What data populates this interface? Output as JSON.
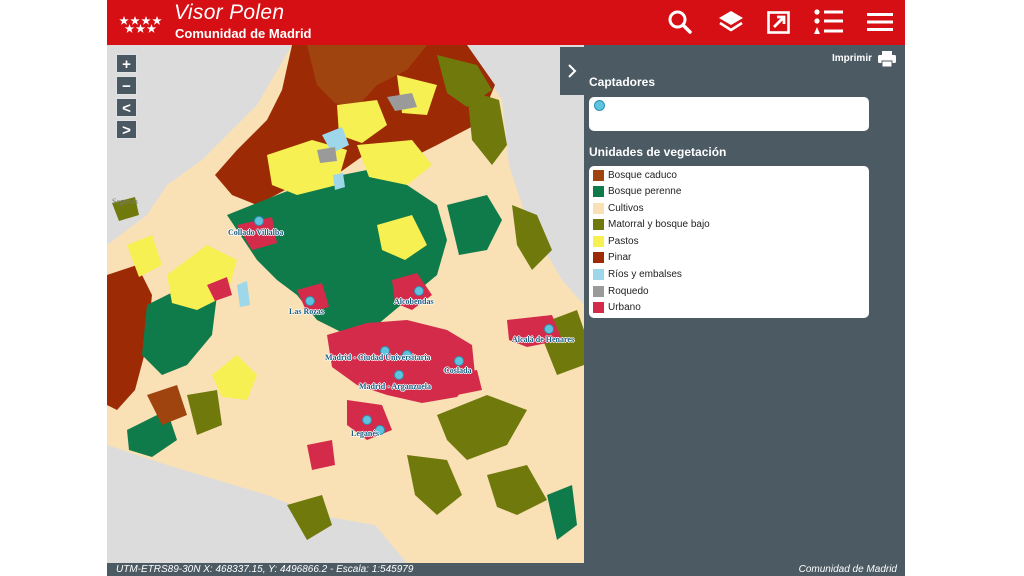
{
  "header": {
    "title": "Visor Polen",
    "subtitle": "Comunidad de Madrid",
    "buttons": [
      {
        "name": "search-button",
        "icon": "search-icon"
      },
      {
        "name": "layers-button",
        "icon": "layers-icon"
      },
      {
        "name": "share-button",
        "icon": "external-link-icon"
      },
      {
        "name": "legend-button",
        "icon": "list-icon"
      },
      {
        "name": "menu-button",
        "icon": "hamburger-icon"
      }
    ]
  },
  "map": {
    "zoom_controls": [
      "+",
      "−",
      "<",
      ">"
    ],
    "background_label": "Segovia",
    "places": [
      {
        "name": "Collado Villalba",
        "sensor": true
      },
      {
        "name": "Alcobendas",
        "sensor": true
      },
      {
        "name": "Las Rozas",
        "sensor": true
      },
      {
        "name": "Alcalá de Henares",
        "sensor": true
      },
      {
        "name": "Madrid - Ciudad Universitaria",
        "sensor": true
      },
      {
        "name": "Coslada",
        "sensor": true
      },
      {
        "name": "Madrid - Arganzuela",
        "sensor": true
      },
      {
        "name": "Leganés",
        "sensor": true
      }
    ]
  },
  "panel": {
    "collapse_icon": "chevron-right-icon",
    "print_label": "Imprimir",
    "captadores_title": "Captadores",
    "vegetation_title": "Unidades de vegetación",
    "legend": [
      {
        "label": "Bosque caduco",
        "color": "#a0440f"
      },
      {
        "label": "Bosque perenne",
        "color": "#0f7a4a"
      },
      {
        "label": "Cultivos",
        "color": "#f9e1b5"
      },
      {
        "label": "Matorral y bosque bajo",
        "color": "#707a0c"
      },
      {
        "label": "Pastos",
        "color": "#f6f052"
      },
      {
        "label": "Pinar",
        "color": "#9c2a05"
      },
      {
        "label": "Ríos y embalses",
        "color": "#9ed6ea"
      },
      {
        "label": "Roquedo",
        "color": "#9a9a9a"
      },
      {
        "label": "Urbano",
        "color": "#d52b4a"
      }
    ]
  },
  "footer": {
    "coordinates": "UTM-ETRS89-30N X: 468337.15, Y: 4496866.2 - Escala: 1:545979",
    "credit": "Comunidad de Madrid"
  },
  "colors": {
    "header_red": "#d50f14",
    "panel_slate": "#4c5a63",
    "sensor_blue": "#5ec3df"
  }
}
